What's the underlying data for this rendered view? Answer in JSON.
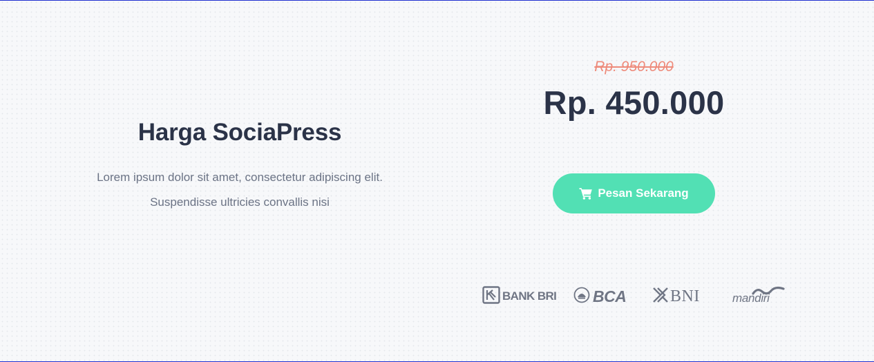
{
  "pricing": {
    "title": "Harga SociaPress",
    "description_line1": "Lorem ipsum dolor sit amet, consectetur adipiscing elit.",
    "description_line2": "Suspendisse ultricies convallis nisi",
    "old_price": "Rp. 950.000",
    "new_price": "Rp. 450.000",
    "order_button": {
      "label": "Pesan Sekarang",
      "icon": "shopping-cart-icon"
    }
  },
  "banks": {
    "bri": "BANK BRI",
    "bca": "BCA",
    "bni": "BNI",
    "mandiri": "mandiri"
  },
  "colors": {
    "heading": "#2b3348",
    "body_text": "#6b7385",
    "old_price": "#ee8a7a",
    "button": "#52e0b4",
    "logo_gray": "#6f7584",
    "frame_border": "#1f2fd0"
  }
}
